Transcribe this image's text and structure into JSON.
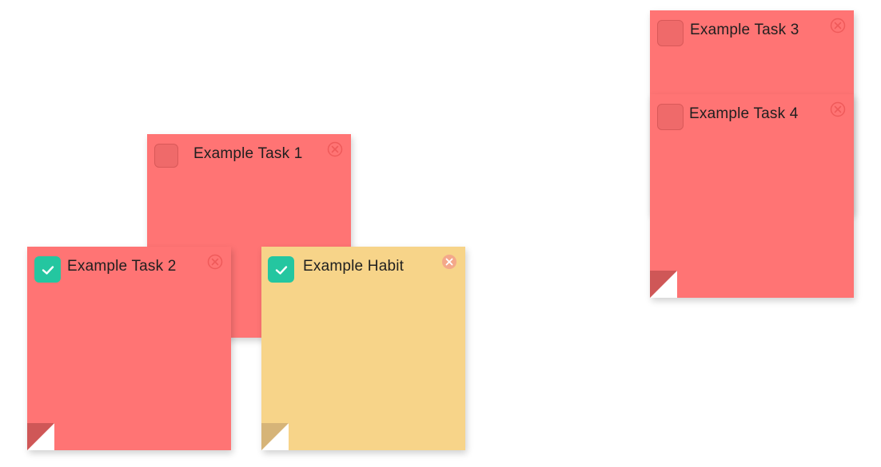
{
  "colors": {
    "task_note": "#ff7474",
    "habit_note": "#f7d489",
    "checkbox_checked": "#24c6a0"
  },
  "notes": [
    {
      "id": "task-1",
      "title": "Example Task 1",
      "type": "task",
      "checked": false
    },
    {
      "id": "task-2",
      "title": "Example Task 2",
      "type": "task",
      "checked": true
    },
    {
      "id": "habit",
      "title": "Example Habit",
      "type": "habit",
      "checked": true
    },
    {
      "id": "task-3",
      "title": "Example Task 3",
      "type": "task",
      "checked": false
    },
    {
      "id": "task-4",
      "title": "Example Task 4",
      "type": "task",
      "checked": false
    }
  ],
  "icons": {
    "close": "close-circle-icon",
    "check": "checkmark-icon"
  }
}
